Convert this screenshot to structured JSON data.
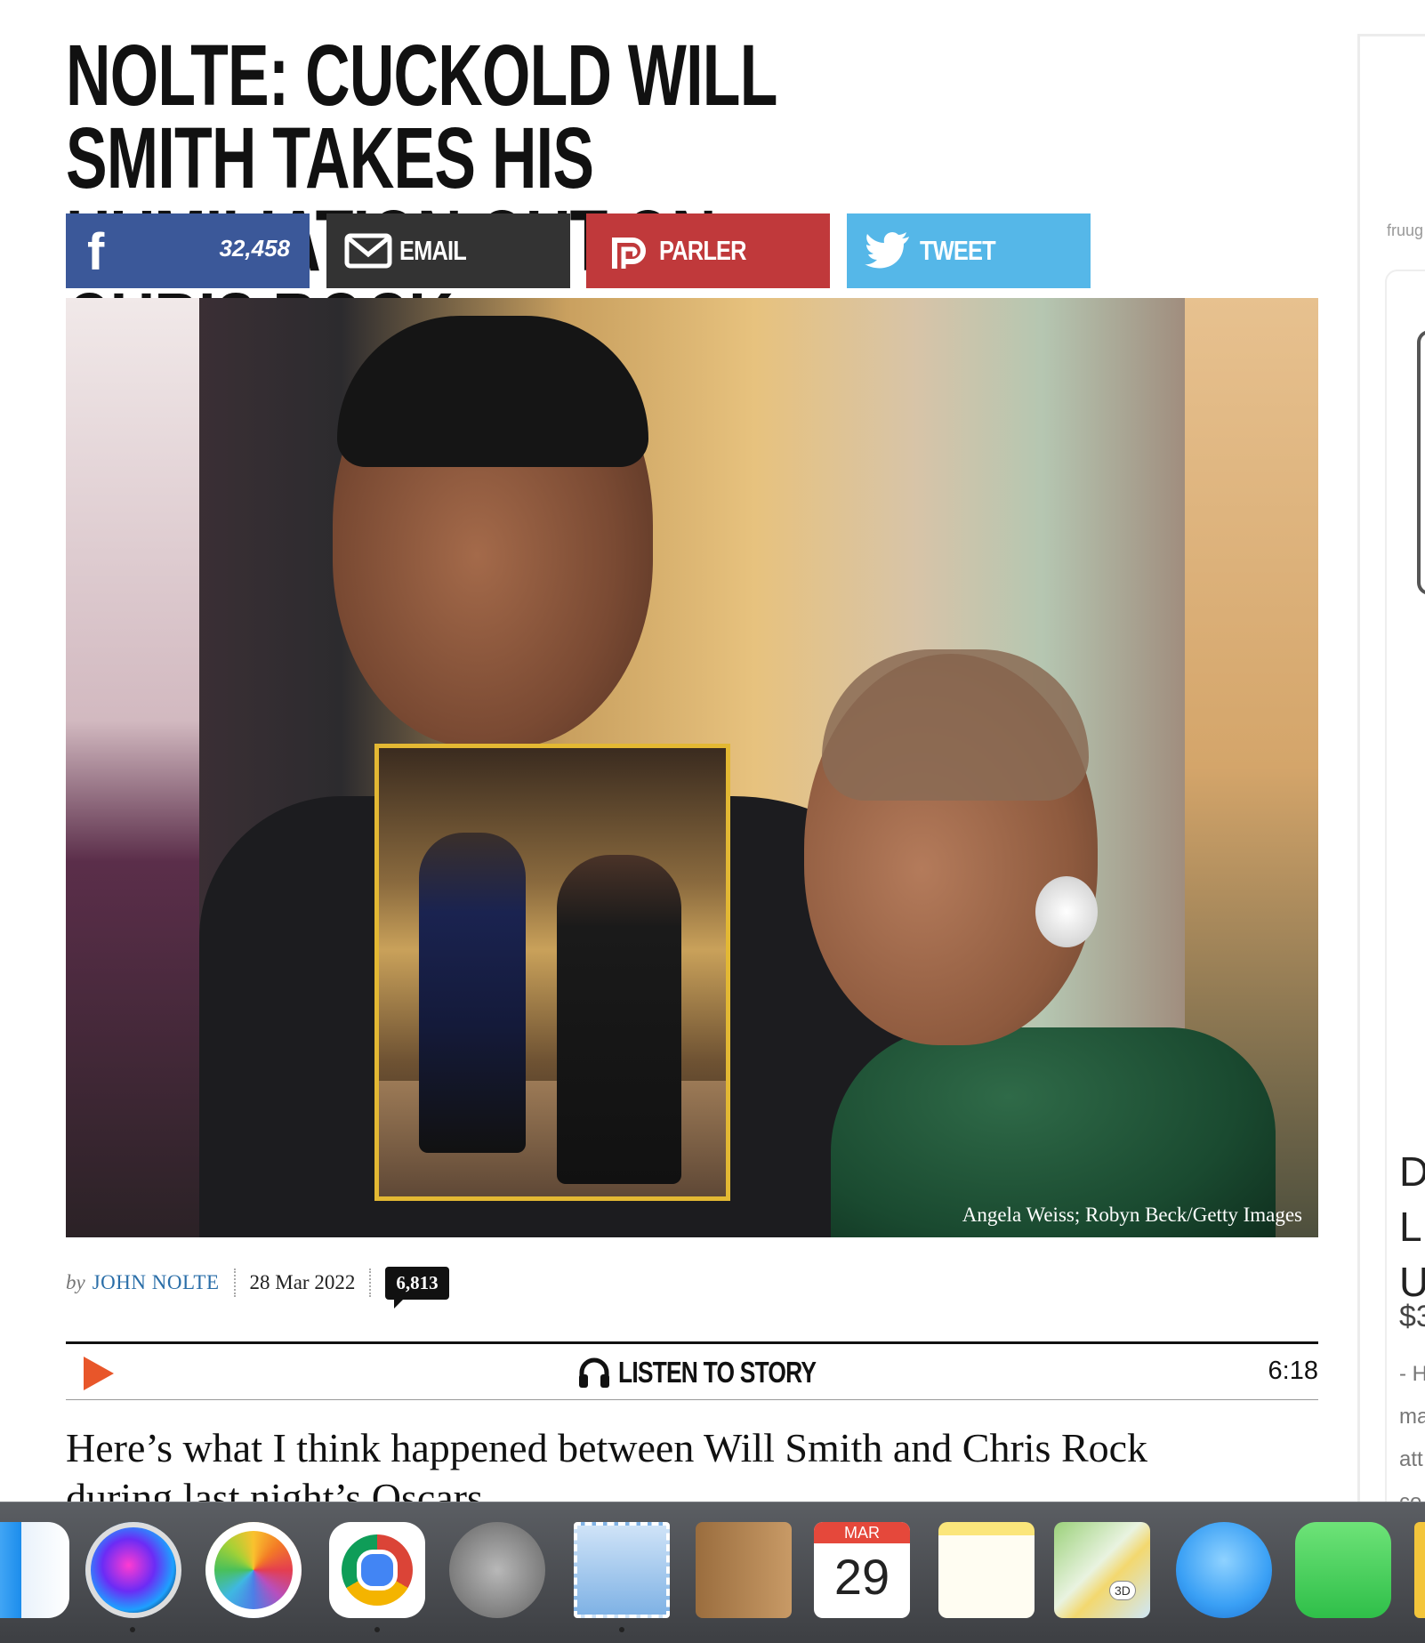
{
  "article": {
    "headline": "NOLTE: CUCKOLD WILL SMITH TAKES HIS HUMILIATION OUT ON CHRIS ROCK",
    "image_credit": "Angela Weiss; Robyn Beck/Getty Images",
    "byline_prefix": "by",
    "author": "JOHN NOLTE",
    "date": "28 Mar 2022",
    "comment_count": "6,813",
    "body_first_line": "Here’s what I think happened between Will Smith and Chris Rock",
    "body_second_line": "during last night’s Oscars"
  },
  "share": {
    "facebook_count": "32,458",
    "email_label": "EMAIL",
    "parler_label": "PARLER",
    "tweet_label": "TWEET"
  },
  "audio": {
    "label": "LISTEN TO STORY",
    "duration": "6:18"
  },
  "sidebar_ad": {
    "brand": "fruug",
    "title_fragment": "D\nL\nU",
    "price_fragment": "$3",
    "desc_fragment": "- H\nma\natt\nco"
  },
  "dock": {
    "calendar_month": "MAR",
    "calendar_day": "29",
    "maps_badge": "3D"
  },
  "colors": {
    "facebook": "#3b5899",
    "email": "#333333",
    "parler": "#c0393b",
    "twitter": "#55b7e8",
    "author_link": "#2a6ea8",
    "play_icon": "#e8562a",
    "inset_border": "#e3b833"
  }
}
